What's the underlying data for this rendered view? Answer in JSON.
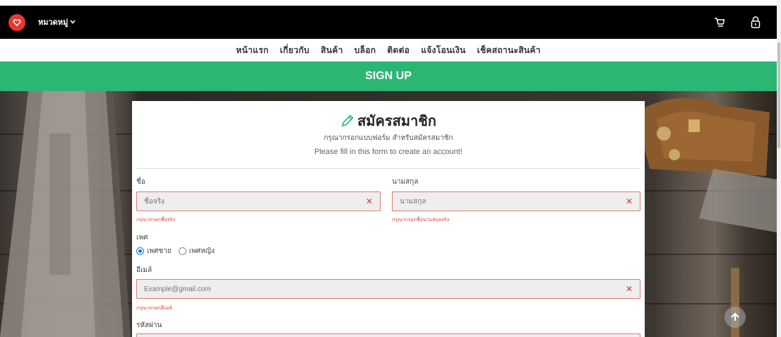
{
  "header": {
    "category_menu_label": "หมวดหมู่",
    "icons": {
      "logo": "heart-shield-icon",
      "cart": "cart-icon",
      "lock": "lock-icon",
      "dropdown": "chevron-down-icon"
    },
    "colors": {
      "topbar": "#000000",
      "logo": "#e8362f"
    }
  },
  "nav": {
    "items": [
      "หน้าแรก",
      "เกี่ยวกับ",
      "สินค้า",
      "บล็อก",
      "ติดต่อ",
      "แจ้งโอนเงิน",
      "เช็คสถานะสินค้า"
    ]
  },
  "banner": {
    "title": "SIGN UP",
    "color": "#2bb673"
  },
  "form": {
    "title": "สมัครสมาชิก",
    "title_icon": "pencil-icon",
    "subtitle_th": "กรุณากรอกแบบฟอร์ม สำหรับสมัครสมาชิก",
    "subtitle_en": "Please fill in this form to create an account!",
    "first_name": {
      "label": "ชื่อ",
      "placeholder": "ชื่อจริง",
      "error": "กรุณากรอกชื่อจริง"
    },
    "last_name": {
      "label": "นามสกุล",
      "placeholder": "นามสกุล",
      "error": "กรุณากรอกชื่อนามสกุลจริง"
    },
    "gender": {
      "label": "เพศ",
      "options": [
        "เพศชาย",
        "เพศหญิง"
      ],
      "selected": "เพศชาย"
    },
    "email": {
      "label": "อีเมล์",
      "placeholder": "Example@gmail.com",
      "error": "กรุณากรอกอีเมล์"
    },
    "password": {
      "label": "รหัสผ่าน"
    },
    "error_color": "#d23c31"
  },
  "scroll_to_top_icon": "arrow-up-icon"
}
